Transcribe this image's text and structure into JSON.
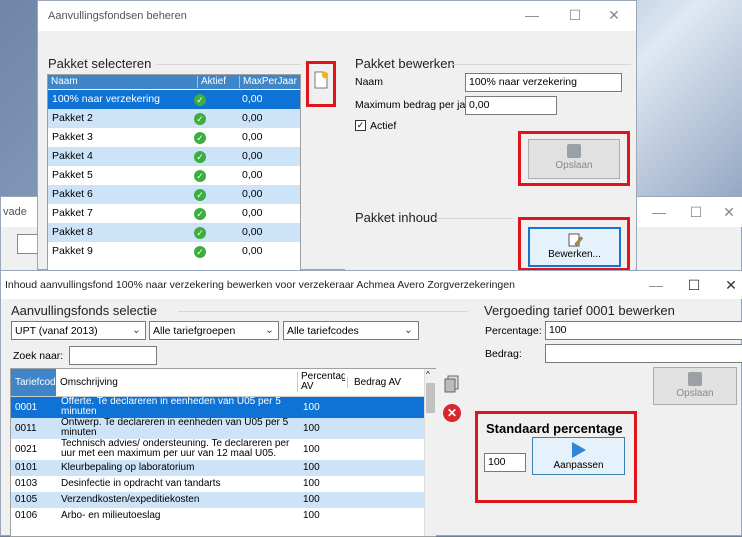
{
  "win1": {
    "title": "Aanvullingsfondsen beheren",
    "minimize": "—",
    "maximize": "☐",
    "close": "✕",
    "pakket_selecteren": "Pakket selecteren",
    "columns": [
      "Naam",
      "Aktief",
      "MaxPerJaar"
    ],
    "rows": [
      {
        "naam": "100% naar verzekering",
        "max": "0,00"
      },
      {
        "naam": "Pakket 2",
        "max": "0,00"
      },
      {
        "naam": "Pakket 3",
        "max": "0,00"
      },
      {
        "naam": "Pakket 4",
        "max": "0,00"
      },
      {
        "naam": "Pakket 5",
        "max": "0,00"
      },
      {
        "naam": "Pakket 6",
        "max": "0,00"
      },
      {
        "naam": "Pakket 7",
        "max": "0,00"
      },
      {
        "naam": "Pakket 8",
        "max": "0,00"
      },
      {
        "naam": "Pakket 9",
        "max": "0,00"
      }
    ],
    "pakket_bewerken": "Pakket bewerken",
    "naam_label": "Naam",
    "naam_value": "100% naar verzekering",
    "max_label": "Maximum bedrag per jaar",
    "max_value": "0,00",
    "actief_label": "Actief",
    "opslaan": "Opslaan",
    "pakket_inhoud": "Pakket inhoud",
    "bewerken": "Bewerken..."
  },
  "bgwin": {
    "partial_title": "vade",
    "minimize": "—",
    "maximize": "☐",
    "close": "✕"
  },
  "win2": {
    "title": "Inhoud aanvullingsfond 100% naar verzekering bewerken voor verzekeraar Achmea Avero Zorgverzekeringen",
    "minimize": "—",
    "maximize": "☐",
    "close": "✕",
    "selectie": "Aanvullingsfonds selectie",
    "combo1": "UPT (vanaf 2013)",
    "combo2": "Alle tariefgroepen",
    "combo3": "Alle tariefcodes",
    "zoek_label": "Zoek naar:",
    "zoek_value": "",
    "columns": [
      "Tariefcode",
      "Omschrijving",
      "Percentage AV",
      "Bedrag AV"
    ],
    "rows": [
      {
        "code": "0001",
        "oms": "Offerte. Te declareren in eenheden van U05 per 5 minuten",
        "pct": "100",
        "bedrag": ""
      },
      {
        "code": "0011",
        "oms": "Ontwerp. Te declareren in eenheden van U05 per 5 minuten",
        "pct": "100",
        "bedrag": ""
      },
      {
        "code": "0021",
        "oms": "Technisch advies/ ondersteuning. Te declareren per uur met een maximum per uur van 12 maal U05.",
        "pct": "100",
        "bedrag": ""
      },
      {
        "code": "0101",
        "oms": "Kleurbepaling op laboratorium",
        "pct": "100",
        "bedrag": ""
      },
      {
        "code": "0103",
        "oms": "Desinfectie in opdracht van tandarts",
        "pct": "100",
        "bedrag": ""
      },
      {
        "code": "0105",
        "oms": "Verzendkosten/expeditiekosten",
        "pct": "100",
        "bedrag": ""
      },
      {
        "code": "0106",
        "oms": "Arbo- en milieutoeslag",
        "pct": "100",
        "bedrag": ""
      }
    ],
    "vergoeding": "Vergoeding tarief 0001 bewerken",
    "pct_label": "Percentage:",
    "pct_value": "100",
    "bedrag_label": "Bedrag:",
    "bedrag_value": "",
    "opslaan": "Opslaan",
    "standaard": "Standaard percentage",
    "std_value": "100",
    "aanpassen": "Aanpassen"
  },
  "colors": {
    "accent": "#0f73d6",
    "header": "#3e86c8",
    "highlight": "#e0141c",
    "alt_row": "#cde3f7"
  }
}
